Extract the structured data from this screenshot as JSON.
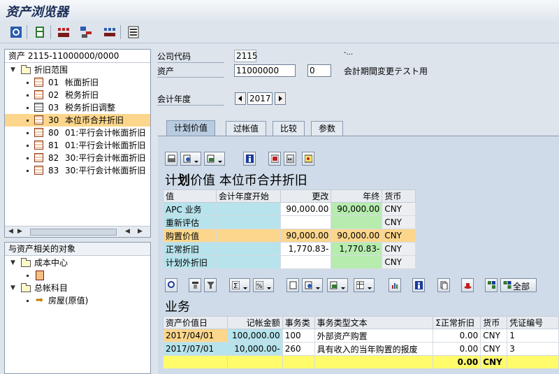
{
  "window": {
    "title": "资产浏览器"
  },
  "toolbar": {
    "icons": [
      "refresh-icon",
      "save-icon",
      "deprec-icon",
      "structure-icon",
      "layout-icon",
      "info-list-icon"
    ]
  },
  "tree": {
    "root": "资产 2115-11000000/0000",
    "group": "折旧范围",
    "items": [
      {
        "code": "01",
        "label": "帐面折旧"
      },
      {
        "code": "02",
        "label": "税务折旧"
      },
      {
        "code": "03",
        "label": "税务折旧调整"
      },
      {
        "code": "30",
        "label": "本位币合并折旧"
      },
      {
        "code": "80",
        "label": "01:平行会计帐面折旧"
      },
      {
        "code": "81",
        "label": "01:平行会计帐面折旧"
      },
      {
        "code": "82",
        "label": "30:平行会计帐面折旧"
      },
      {
        "code": "83",
        "label": "30:平行会计帐面折旧"
      }
    ]
  },
  "objects": {
    "title": "与资产相关的对象",
    "cost_center": "成本中心",
    "gl": "总帐科目",
    "gl_item": "房屋(原值)"
  },
  "header": {
    "company_label": "公司代码",
    "company_value": "2115",
    "company_name": "-...",
    "asset_label": "资产",
    "asset_value": "11000000",
    "asset_sub": "0",
    "asset_desc": "会計期間変更テスト用",
    "fy_label": "会计年度",
    "fy_value": "2017"
  },
  "tabs": [
    "计划价值",
    "过帐值",
    "比较",
    "参数"
  ],
  "planned": {
    "title_a": "计",
    "title_b": "划",
    "title_c": "价值 本位币合并折旧",
    "columns": [
      "值",
      "会计年度开始",
      "更改",
      "年终",
      "货币"
    ],
    "rows": [
      {
        "name": "APC 业务",
        "start": "",
        "change": "90,000.00",
        "end": "90,000.00",
        "cur": "CNY"
      },
      {
        "name": "重新评估",
        "start": "",
        "change": "",
        "end": "",
        "cur": "CNY"
      },
      {
        "name": "购置价值",
        "start": "",
        "change": "90,000.00",
        "end": "90,000.00",
        "cur": "CNY"
      },
      {
        "name": "正常折旧",
        "start": "",
        "change": "1,770.83-",
        "end": "1,770.83-",
        "cur": "CNY"
      },
      {
        "name": "计划外折旧",
        "start": "",
        "change": "",
        "end": "",
        "cur": "CNY"
      }
    ]
  },
  "trans": {
    "title": "业务",
    "all_label": "全部",
    "columns": [
      "资产价值日",
      "记帐金额",
      "事务类",
      "事务类型文本",
      "Σ正常折旧",
      "货币",
      "凭证编号"
    ],
    "rows": [
      {
        "date": "2017/04/01",
        "amount": "100,000.00",
        "type": "100",
        "text": "外部资产购置",
        "dep": "0.00",
        "cur": "CNY",
        "doc": "1"
      },
      {
        "date": "2017/07/01",
        "amount": "10,000.00-",
        "type": "260",
        "text": "具有收入的当年购置的报废",
        "dep": "0.00",
        "cur": "CNY",
        "doc": "3"
      }
    ],
    "total": {
      "dep": "0.00",
      "cur": "CNY"
    }
  }
}
